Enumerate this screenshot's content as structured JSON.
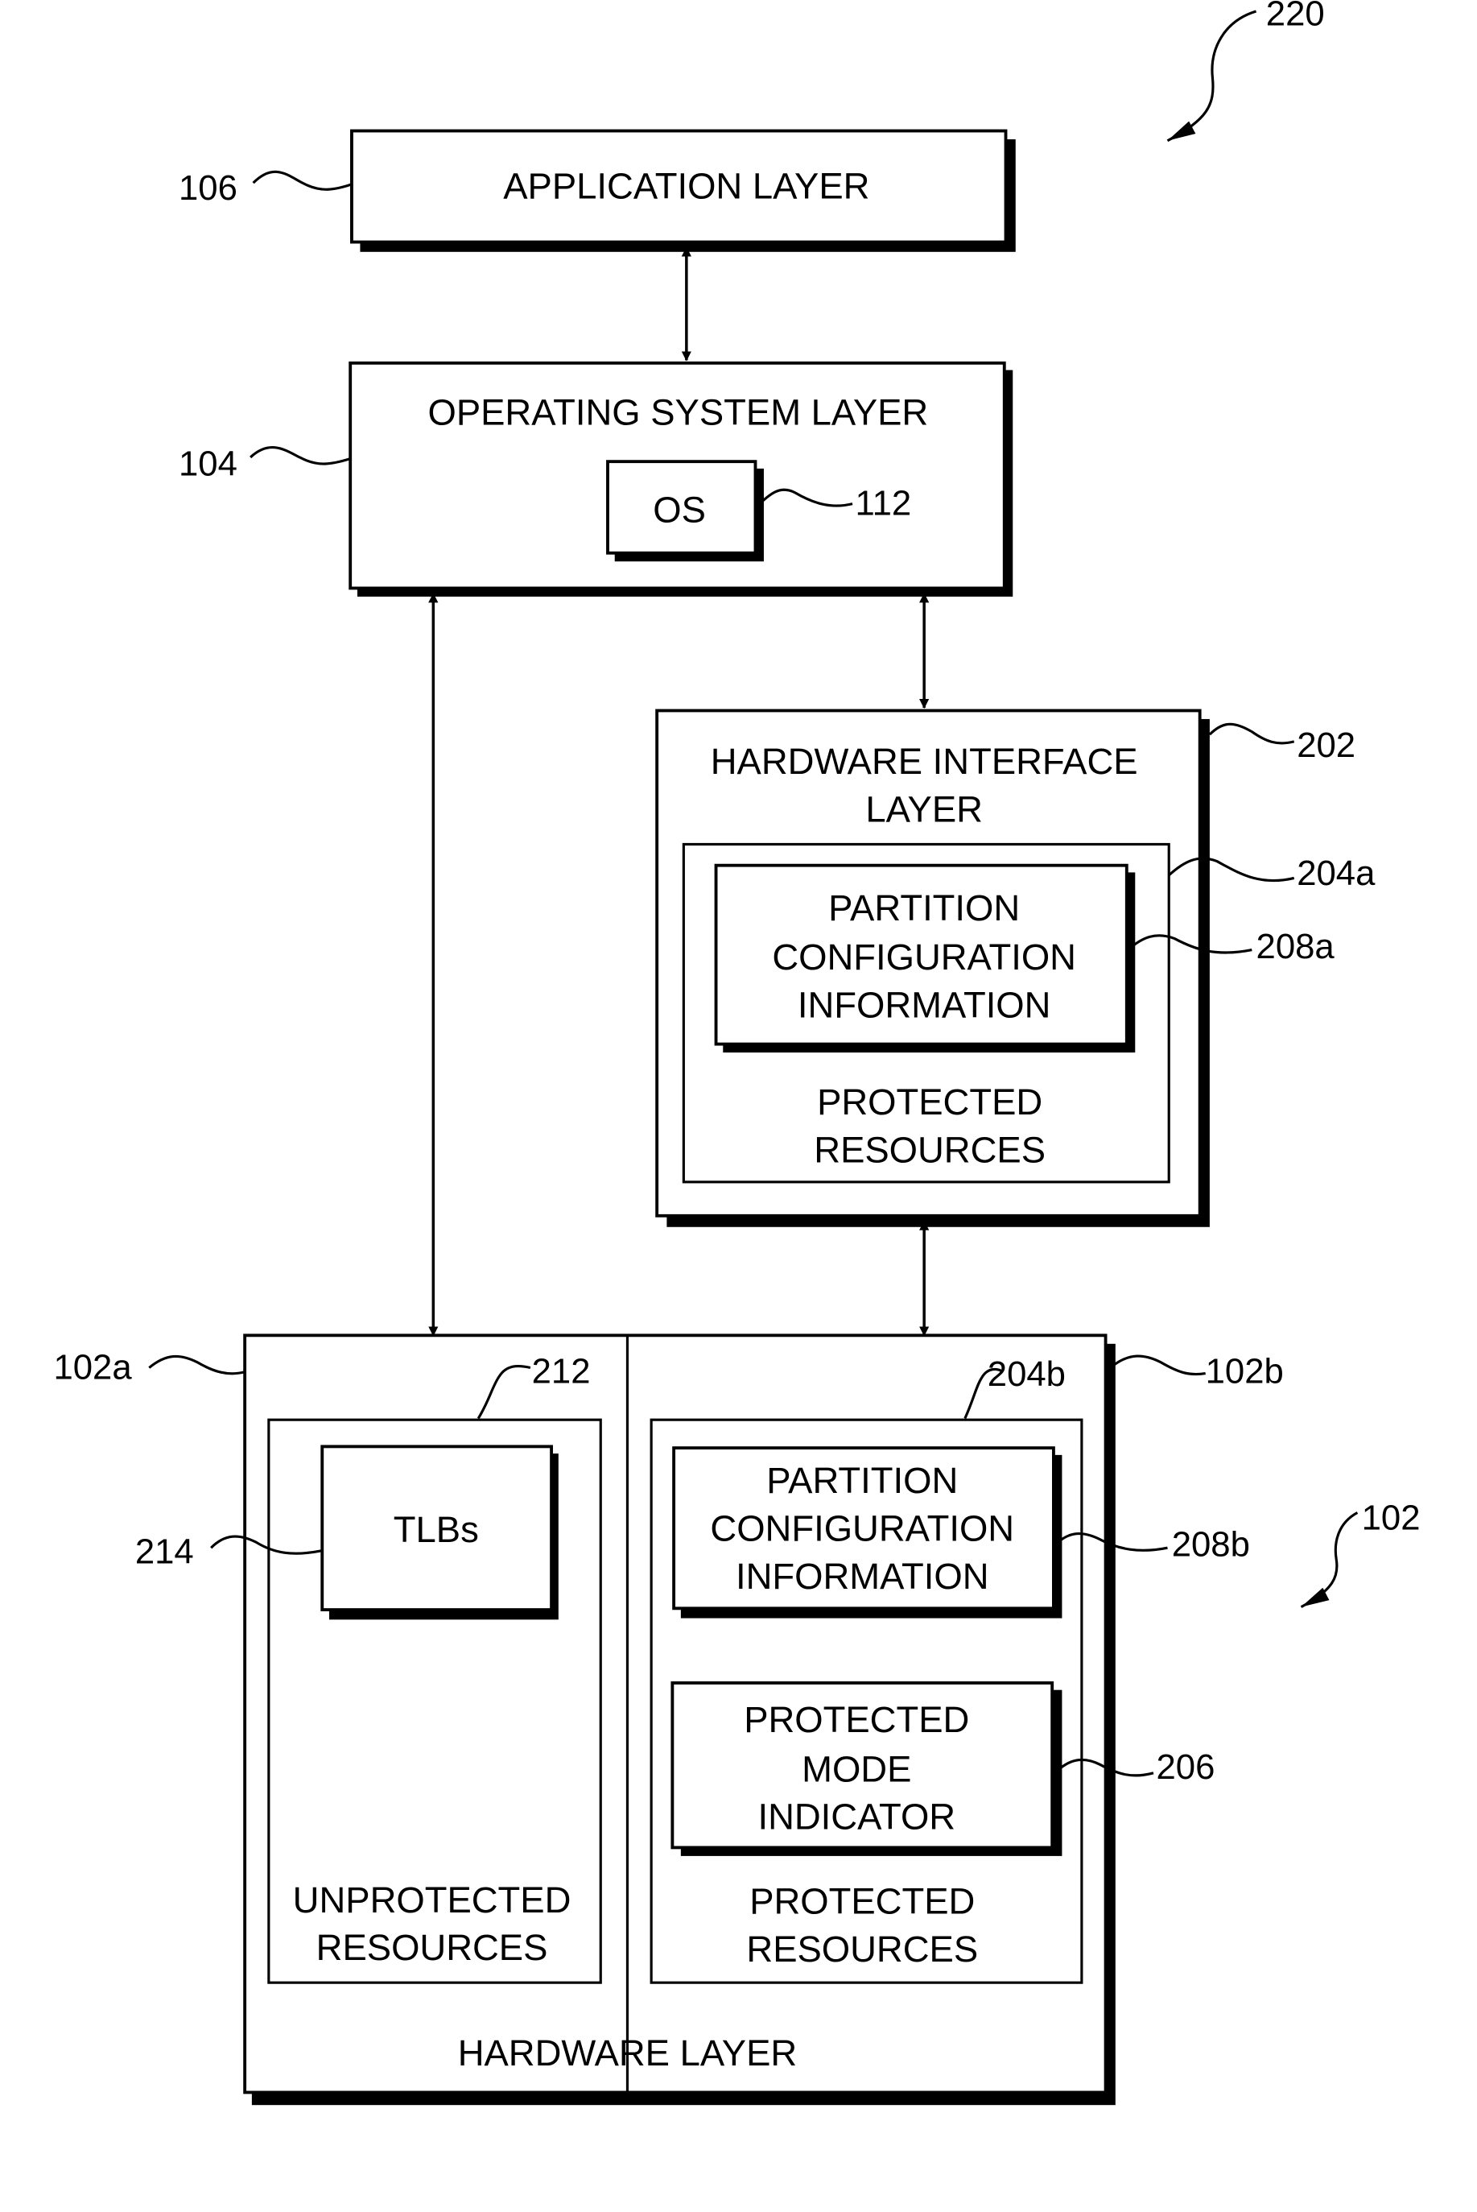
{
  "figure": {
    "ref_overall": "220",
    "ref_hardware": "102"
  },
  "application_layer": {
    "label": "APPLICATION LAYER",
    "ref": "106"
  },
  "operating_system_layer": {
    "label": "OPERATING SYSTEM LAYER",
    "ref": "104",
    "os": {
      "label": "OS",
      "ref": "112"
    }
  },
  "hardware_interface_layer": {
    "label_lines": [
      "HARDWARE INTERFACE",
      "LAYER"
    ],
    "ref": "202",
    "protected_resources": {
      "ref": "204a",
      "label_lines": [
        "PROTECTED",
        "RESOURCES"
      ],
      "partition_config": {
        "ref": "208a",
        "label_lines": [
          "PARTITION",
          "CONFIGURATION",
          "INFORMATION"
        ]
      }
    }
  },
  "hardware_layer": {
    "label": "HARDWARE LAYER",
    "left_ref": "102a",
    "right_ref": "102b",
    "unprotected_resources": {
      "ref": "212",
      "label_lines": [
        "UNPROTECTED",
        "RESOURCES"
      ],
      "tlbs": {
        "label": "TLBs",
        "ref": "214"
      }
    },
    "protected_resources": {
      "ref": "204b",
      "label_lines": [
        "PROTECTED",
        "RESOURCES"
      ],
      "partition_config": {
        "ref": "208b",
        "label_lines": [
          "PARTITION",
          "CONFIGURATION",
          "INFORMATION"
        ]
      },
      "protected_mode_indicator": {
        "ref": "206",
        "label_lines": [
          "PROTECTED",
          "MODE",
          "INDICATOR"
        ]
      }
    }
  }
}
